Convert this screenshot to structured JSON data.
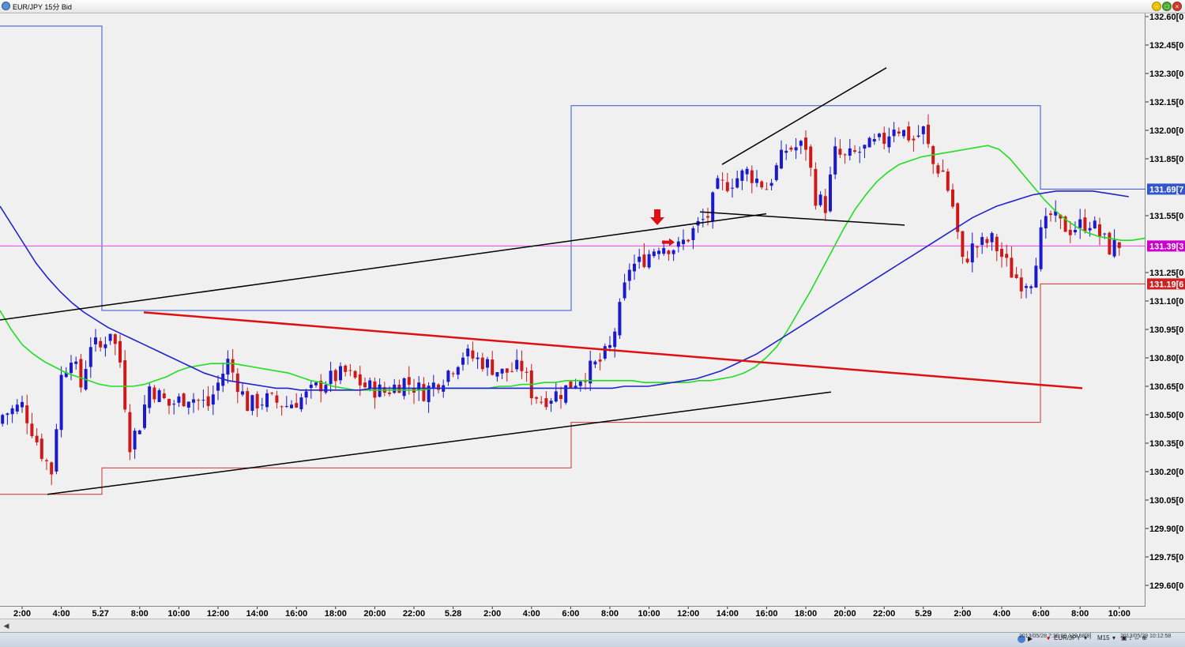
{
  "window": {
    "title": "EUR/JPY 15分 Bid"
  },
  "toolbar_bottom": {
    "symbol_select": "EUR/JPY",
    "timeframe_select": "M15",
    "cursor_info": "2013/05/28 7:30:00  129.58[8]",
    "time_info": "2013/05/29 10:12:58"
  },
  "colors": {
    "background": "#f0f0f0",
    "bull_candle": "#1a1acc",
    "bear_candle": "#cc1a1a",
    "ma_fast": "#22dd22",
    "ma_slow": "#2222cc",
    "trendline_red": "#dd1111",
    "trendline_black": "#000000",
    "box_blue": "#3355cc",
    "box_red": "#cc3333",
    "current_price_line": "#ee44ee"
  },
  "chart_data": {
    "type": "candlestick",
    "symbol": "EUR/JPY",
    "timeframe": "15分",
    "ylim": [
      129.55,
      132.68
    ],
    "y_ticks": [
      "132.60[0",
      "132.45[0",
      "132.30[0",
      "132.15[0",
      "132.00[0",
      "131.85[0",
      "131.55[0",
      "131.25[0",
      "131.10[0",
      "130.95[0",
      "130.80[0",
      "130.65[0",
      "130.50[0",
      "130.35[0",
      "130.20[0",
      "130.05[0",
      "129.90[0",
      "129.75[0",
      "129.60[0"
    ],
    "x_ticks": [
      "2:00",
      "4:00",
      "5.27",
      "8:00",
      "10:00",
      "12:00",
      "14:00",
      "16:00",
      "18:00",
      "20:00",
      "22:00",
      "5.28",
      "2:00",
      "4:00",
      "6:00",
      "8:00",
      "10:00",
      "12:00",
      "14:00",
      "16:00",
      "18:00",
      "20:00",
      "22:00",
      "5.29",
      "2:00",
      "4:00",
      "6:00",
      "8:00",
      "10:00"
    ],
    "price_tags": [
      {
        "label": "131.69[7",
        "value": 131.69,
        "color": "#3355cc"
      },
      {
        "label": "131.39[3",
        "value": 131.39,
        "color": "#cc00cc"
      },
      {
        "label": "131.19[6",
        "value": 131.19,
        "color": "#cc2222"
      }
    ],
    "current_price": 131.39,
    "ma_fast": [
      131.05,
      130.95,
      130.87,
      130.82,
      130.78,
      130.75,
      130.72,
      130.7,
      130.68,
      130.66,
      130.65,
      130.65,
      130.65,
      130.66,
      130.68,
      130.7,
      130.73,
      130.75,
      130.76,
      130.77,
      130.77,
      130.77,
      130.76,
      130.75,
      130.74,
      130.73,
      130.72,
      130.7,
      130.68,
      130.67,
      130.65,
      130.64,
      130.63,
      130.63,
      130.63,
      130.63,
      130.63,
      130.63,
      130.63,
      130.64,
      130.64,
      130.64,
      130.64,
      130.64,
      130.64,
      130.65,
      130.65,
      130.66,
      130.66,
      130.67,
      130.67,
      130.68,
      130.68,
      130.68,
      130.68,
      130.68,
      130.68,
      130.68,
      130.67,
      130.67,
      130.67,
      130.67,
      130.67,
      130.68,
      130.68,
      130.69,
      130.7,
      130.72,
      130.75,
      130.8,
      130.86,
      130.95,
      131.05,
      131.15,
      131.26,
      131.37,
      131.48,
      131.58,
      131.66,
      131.73,
      131.78,
      131.82,
      131.84,
      131.86,
      131.87,
      131.88,
      131.89,
      131.9,
      131.91,
      131.92,
      131.9,
      131.85,
      131.78,
      131.71,
      131.64,
      131.58,
      131.53,
      131.49,
      131.46,
      131.44,
      131.43,
      131.42,
      131.42,
      131.43,
      131.44,
      131.45,
      131.46
    ],
    "ma_slow": [
      131.6,
      131.5,
      131.4,
      131.3,
      131.22,
      131.15,
      131.09,
      131.04,
      131.0,
      130.96,
      130.93,
      130.9,
      130.87,
      130.84,
      130.81,
      130.78,
      130.75,
      130.72,
      130.7,
      130.68,
      130.67,
      130.66,
      130.65,
      130.64,
      130.64,
      130.63,
      130.63,
      130.63,
      130.63,
      130.63,
      130.63,
      130.64,
      130.64,
      130.64,
      130.64,
      130.64,
      130.64,
      130.64,
      130.64,
      130.64,
      130.64,
      130.64,
      130.64,
      130.64,
      130.64,
      130.64,
      130.64,
      130.64,
      130.64,
      130.64,
      130.64,
      130.64,
      130.65,
      130.65,
      130.65,
      130.66,
      130.67,
      130.68,
      130.69,
      130.71,
      130.73,
      130.76,
      130.79,
      130.82,
      130.86,
      130.9,
      130.94,
      130.98,
      131.02,
      131.06,
      131.1,
      131.14,
      131.18,
      131.22,
      131.26,
      131.3,
      131.34,
      131.38,
      131.42,
      131.46,
      131.5,
      131.54,
      131.57,
      131.6,
      131.62,
      131.64,
      131.66,
      131.67,
      131.68,
      131.68,
      131.68,
      131.68,
      131.67,
      131.66,
      131.65
    ],
    "trendlines": [
      {
        "color": "black",
        "from": [
          "1:30 5/27",
          130.98
        ],
        "to": [
          "18:00 5/28 (approx)",
          131.56
        ]
      },
      {
        "color": "black",
        "from": [
          "3:00 5/27",
          130.1
        ],
        "to": [
          "20:00 5/28",
          130.62
        ]
      },
      {
        "color": "red",
        "from": [
          "8:30 5/27",
          131.05
        ],
        "to": [
          "8:00 5/29",
          130.65
        ]
      },
      {
        "color": "black",
        "from": [
          "13:30 5/28",
          131.82
        ],
        "to": [
          "22:00 5/28",
          132.33
        ]
      },
      {
        "color": "black",
        "from": [
          "13:30 5/28",
          131.57
        ],
        "to": [
          "23:00 5/28",
          131.5
        ]
      }
    ],
    "range_boxes": [
      {
        "color": "blue",
        "high": 132.55,
        "low": 131.05
      },
      {
        "color": "red",
        "high": 130.22,
        "low": 130.08
      },
      {
        "color": "blue",
        "high": 132.13,
        "low": 131.05
      },
      {
        "color": "red",
        "high": 130.46,
        "low": 130.28
      },
      {
        "color": "blue",
        "high": 132.13,
        "low": 131.69
      },
      {
        "color": "red",
        "high": 131.19,
        "low": 130.46
      }
    ],
    "markers": [
      {
        "type": "down-arrow",
        "time": "10:30 5/28",
        "color": "red"
      },
      {
        "type": "right-arrow",
        "time": "10:45 5/28",
        "color": "red"
      }
    ]
  }
}
